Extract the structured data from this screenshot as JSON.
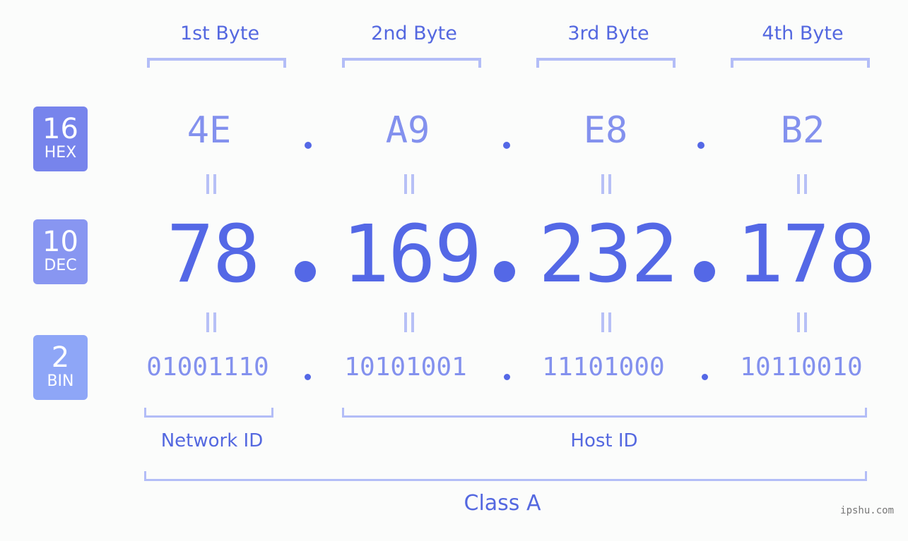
{
  "byte_headers": [
    "1st Byte",
    "2nd Byte",
    "3rd Byte",
    "4th Byte"
  ],
  "badges": {
    "hex": {
      "base": "16",
      "label": "HEX",
      "color": "#7784ec"
    },
    "dec": {
      "base": "10",
      "label": "DEC",
      "color": "#8896f1"
    },
    "bin": {
      "base": "2",
      "label": "BIN",
      "color": "#8ea6f7"
    }
  },
  "hex_values": [
    "4E",
    "A9",
    "E8",
    "B2"
  ],
  "dec_values": [
    "78",
    "169",
    "232",
    "178"
  ],
  "bin_values": [
    "01001110",
    "10101001",
    "11101000",
    "10110010"
  ],
  "equals_symbol": "=",
  "segments": {
    "network_id": "Network ID",
    "host_id": "Host ID",
    "ip_class": "Class A"
  },
  "watermark": "ipshu.com"
}
